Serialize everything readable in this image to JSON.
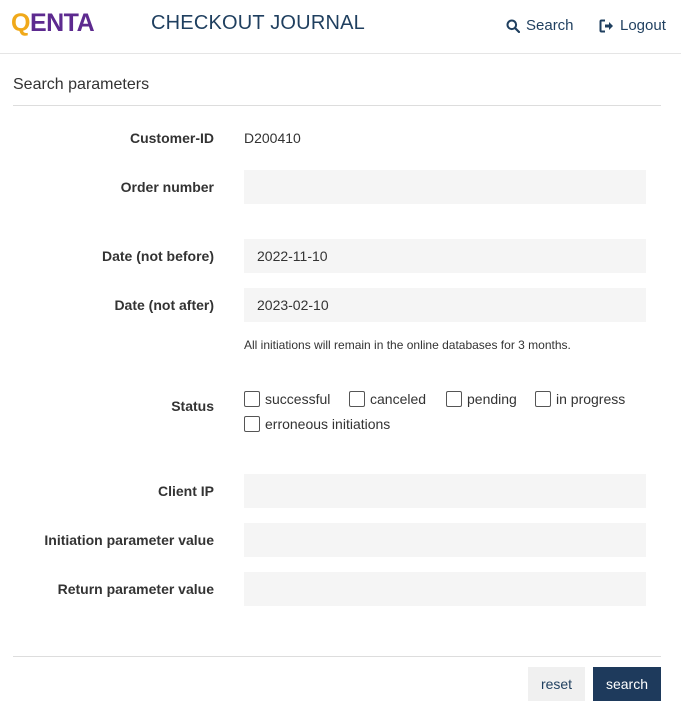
{
  "header": {
    "logo_q": "Q",
    "logo_rest": "ENTA",
    "title": "CHECKOUT JOURNAL",
    "search_link": "Search",
    "logout_link": "Logout"
  },
  "form": {
    "section_title": "Search parameters",
    "customer_id_label": "Customer-ID",
    "customer_id_value": "D200410",
    "order_number_label": "Order number",
    "order_number_value": "",
    "date_not_before_label": "Date (not before)",
    "date_not_before_value": "2022-11-10",
    "date_not_after_label": "Date (not after)",
    "date_not_after_value": "2023-02-10",
    "retention_hint": "All initiations will remain in the online databases for 3 months.",
    "status_label": "Status",
    "status_options": [
      "successful",
      "canceled",
      "pending",
      "in progress",
      "erroneous initiations"
    ],
    "status_checked": [
      false,
      false,
      false,
      false,
      false
    ],
    "client_ip_label": "Client IP",
    "client_ip_value": "",
    "initiation_param_label": "Initiation parameter value",
    "initiation_param_value": "",
    "return_param_label": "Return parameter value",
    "return_param_value": ""
  },
  "actions": {
    "reset_label": "reset",
    "search_label": "search"
  },
  "colors": {
    "logo_q": "#f0a91a",
    "logo_text": "#5d2a8f",
    "primary": "#1e3a5c",
    "nav_text": "#1f3f5f",
    "field_bg": "#f5f5f5"
  },
  "icons": {
    "search_link": "magnifier-icon",
    "logout_link": "logout-icon"
  }
}
